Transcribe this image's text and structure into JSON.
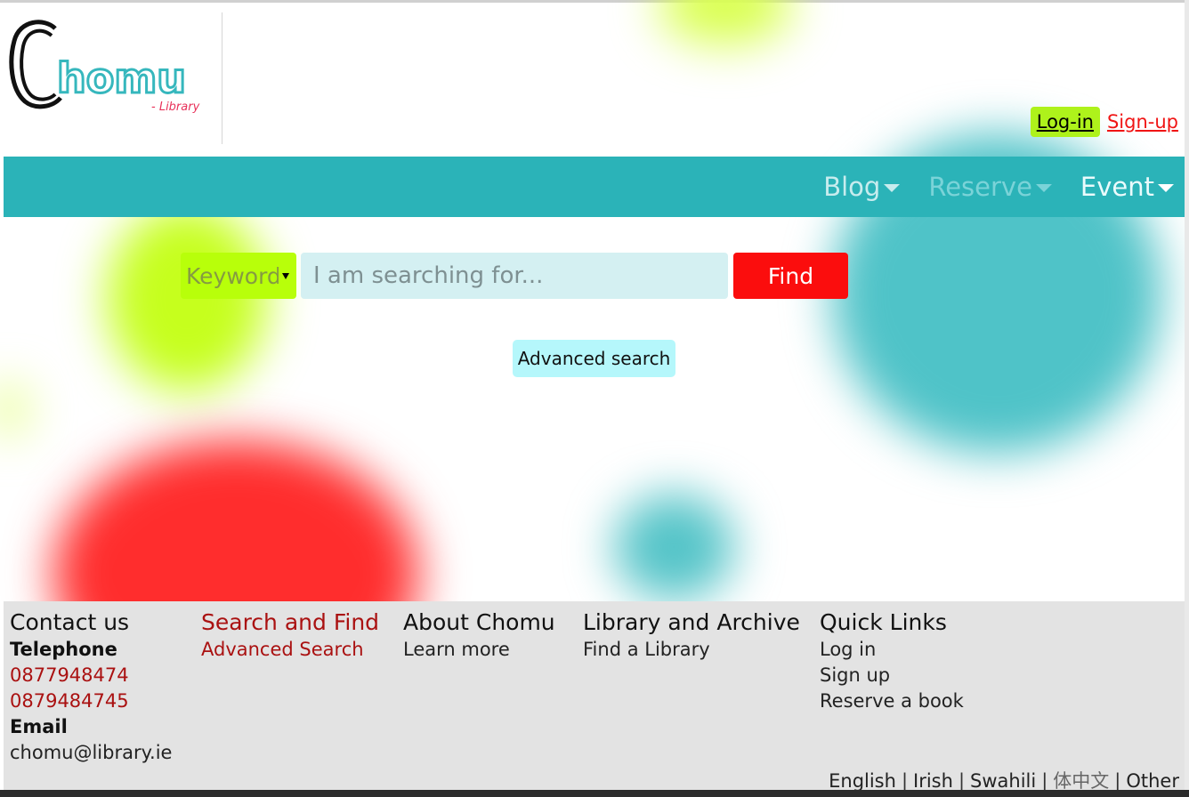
{
  "brand": {
    "name": "Chomu",
    "logo_first_letter": "C",
    "logo_rest": "homu",
    "tagline": "- Library",
    "colors": {
      "teal": "#2bb3b8",
      "lime": "#b8ff0a",
      "red": "#fb0d0d"
    }
  },
  "auth": {
    "login_label": "Log-in",
    "signup_label": "Sign-up"
  },
  "nav": {
    "items": [
      {
        "label": "Blog"
      },
      {
        "label": "Reserve"
      },
      {
        "label": "Event"
      }
    ]
  },
  "search": {
    "type_value": "Keyword",
    "placeholder": "I am searching for...",
    "find_label": "Find",
    "advanced_label": "Advanced search"
  },
  "footer": {
    "contact": {
      "heading": "Contact us",
      "telephone_label": "Telephone",
      "phones": [
        "0877948474",
        "0879484745"
      ],
      "email_label": "Email",
      "email": "chomu@library.ie"
    },
    "search_find": {
      "heading": "Search and Find",
      "links": [
        "Advanced Search"
      ]
    },
    "about": {
      "heading": "About Chomu",
      "links": [
        "Learn more"
      ]
    },
    "library": {
      "heading": "Library and Archive",
      "links": [
        "Find a Library"
      ]
    },
    "quick": {
      "heading": "Quick Links",
      "links": [
        "Log in",
        "Sign up",
        "Reserve a book"
      ]
    },
    "languages": [
      "English",
      "Irish",
      "Swahili",
      "体中文",
      "Other"
    ]
  }
}
